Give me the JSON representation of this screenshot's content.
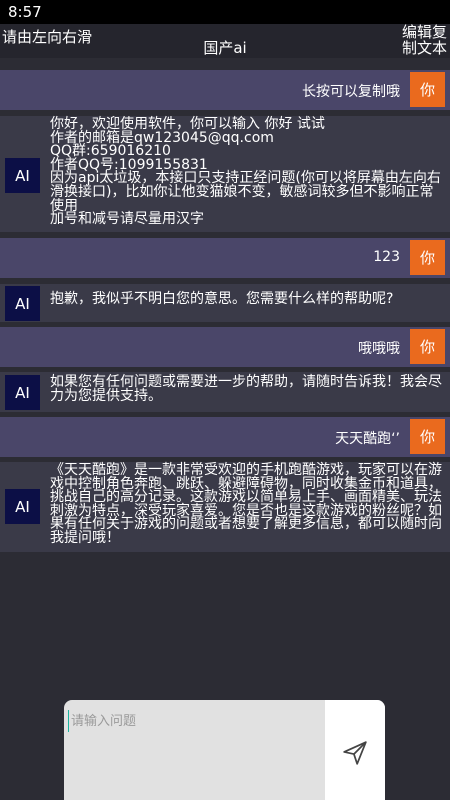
{
  "status_bar": {
    "time": "8:57"
  },
  "header": {
    "left_hint": "请由左向右滑",
    "title": "国产ai",
    "edit_label_line1": "编辑复",
    "edit_label_line2": "制文本"
  },
  "messages": [
    {
      "role": "user",
      "avatar_label": "你",
      "text": "长按可以复制哦"
    },
    {
      "role": "ai",
      "avatar_label": "AI",
      "text": "你好，欢迎使用软件，你可以输入 你好 试试\n作者的邮箱是qw123045@qq.com\nQQ群:659016210\n作者QQ号:1099155831\n因为api太垃圾，本接口只支持正经问题(你可以将屏幕由左向右滑换接口)，比如你让他变猫娘不变，敏感词较多但不影响正常使用\n加号和减号请尽量用汉字"
    },
    {
      "role": "user",
      "avatar_label": "你",
      "text": "123"
    },
    {
      "role": "ai",
      "avatar_label": "AI",
      "text": "抱歉，我似乎不明白您的意思。您需要什么样的帮助呢?"
    },
    {
      "role": "user",
      "avatar_label": "你",
      "text": "哦哦哦"
    },
    {
      "role": "ai",
      "avatar_label": "AI",
      "text": "如果您有任何问题或需要进一步的帮助，请随时告诉我！我会尽力为您提供支持。"
    },
    {
      "role": "user",
      "avatar_label": "你",
      "text": "天天酷跑‘’"
    },
    {
      "role": "ai",
      "avatar_label": "AI",
      "text": "《天天酷跑》是一款非常受欢迎的手机跑酷游戏，玩家可以在游戏中控制角色奔跑、跳跃、躲避障碍物，同时收集金币和道具，挑战自己的高分记录。这款游戏以简单易上手、画面精美、玩法刺激为特点，深受玩家喜爱。您是否也是这款游戏的粉丝呢？如果有任何关于游戏的问题或者想要了解更多信息，都可以随时向我提问哦！"
    }
  ],
  "composer": {
    "placeholder": "请输入问题",
    "value": ""
  },
  "icons": {
    "send": "send-icon"
  },
  "colors": {
    "user_avatar": "#ea6a1e",
    "ai_avatar": "#0c0f46",
    "user_row": "#4a4669",
    "ai_row": "#3a3a48"
  }
}
